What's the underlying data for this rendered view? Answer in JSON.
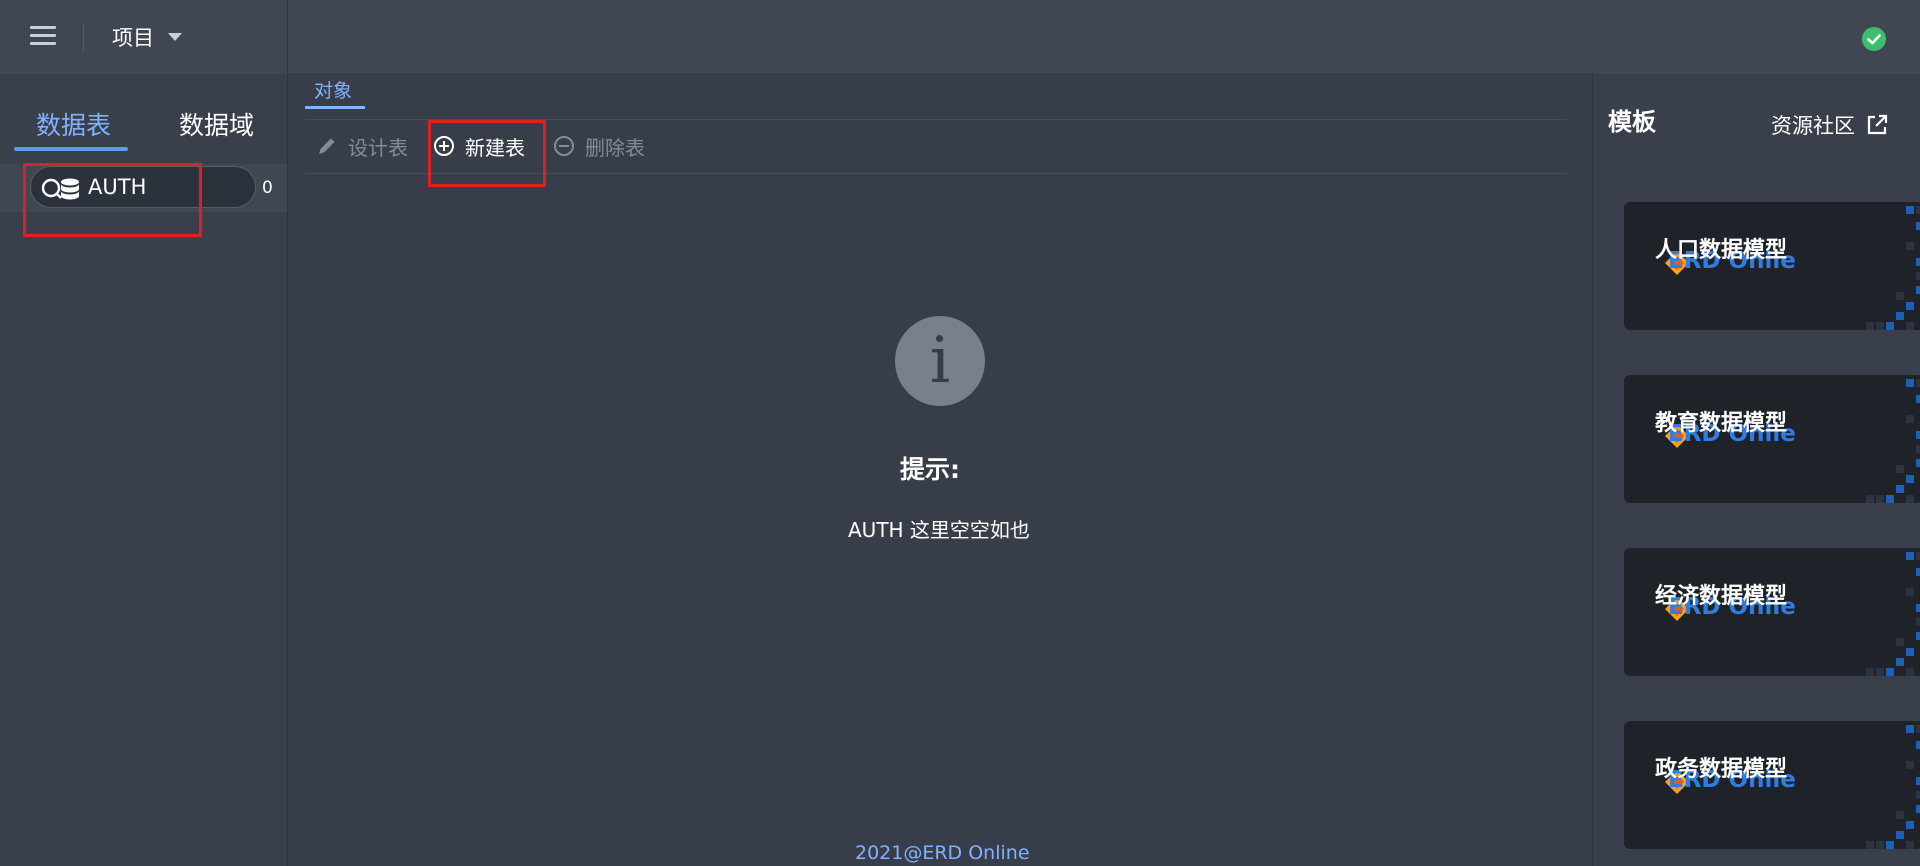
{
  "header": {
    "project_label": "项目"
  },
  "sidebar": {
    "tabs": [
      {
        "label": "数据表",
        "active": true
      },
      {
        "label": "数据域",
        "active": false
      }
    ],
    "databases": [
      {
        "name": "AUTH",
        "count": "0"
      }
    ]
  },
  "main": {
    "tabs": [
      {
        "label": "对象",
        "active": true
      }
    ],
    "toolbar": {
      "design_label": "设计表",
      "new_label": "新建表",
      "delete_label": "删除表"
    },
    "empty": {
      "title": "提示:",
      "message": "AUTH 这里空空如也"
    },
    "footer": "2021@ERD Online"
  },
  "templates": {
    "title": "模板",
    "resource_link": "资源社区",
    "brand": "ERD Onlie",
    "cards": [
      {
        "name": "人口数据模型"
      },
      {
        "name": "教育数据模型"
      },
      {
        "name": "经济数据模型"
      },
      {
        "name": "政务数据模型"
      }
    ]
  },
  "colors": {
    "accent": "#7fb2ff",
    "success": "#3bbf6e",
    "highlight": "#e02020"
  }
}
